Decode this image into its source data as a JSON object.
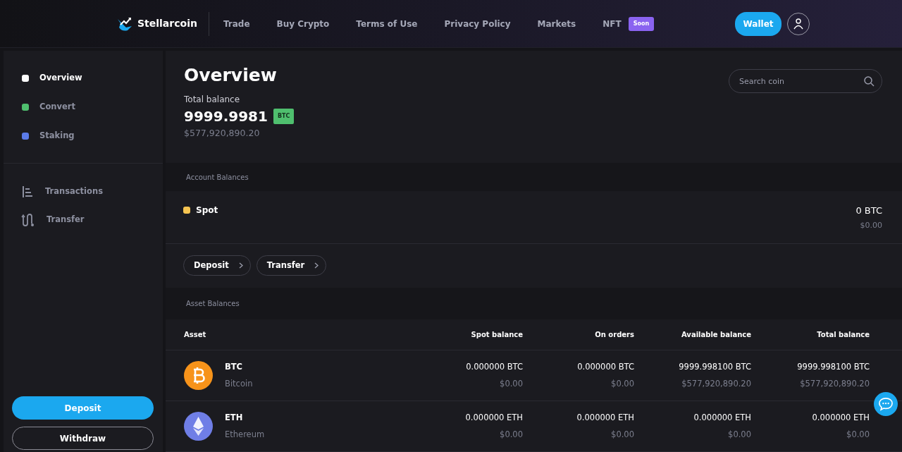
{
  "header": {
    "brand": "Stellarcoin",
    "nav": [
      {
        "label": "Trade"
      },
      {
        "label": "Buy Crypto"
      },
      {
        "label": "Terms of Use"
      },
      {
        "label": "Privacy Policy"
      },
      {
        "label": "Markets"
      },
      {
        "label": "NFT",
        "badge": "Soon"
      }
    ],
    "wallet_button": "Wallet"
  },
  "sidebar": {
    "items": [
      {
        "label": "Overview",
        "color": "#ffffff",
        "selected": true
      },
      {
        "label": "Convert",
        "color": "#4fbf6e",
        "selected": false
      },
      {
        "label": "Staking",
        "color": "#5b7be8",
        "selected": false
      }
    ],
    "links": [
      {
        "label": "Transactions",
        "kind": "list"
      },
      {
        "label": "Transfer",
        "kind": "route"
      }
    ],
    "deposit_button": "Deposit",
    "withdraw_button": "Withdraw"
  },
  "overview": {
    "title": "Overview",
    "balance_label": "Total balance",
    "balance": "9999.9981",
    "unit": "BTC",
    "fiat": "$577,920,890.20",
    "search": {
      "placeholder": "Search coin"
    }
  },
  "account_balances": {
    "title": "Account Balances",
    "accounts": [
      {
        "name": "Spot",
        "color": "#f5c451",
        "amount": "0 BTC",
        "fiat": "$0.00"
      }
    ],
    "actions": [
      "Deposit",
      "Transfer"
    ]
  },
  "asset_balances": {
    "title": "Asset Balances",
    "columns": [
      "Asset",
      "Spot balance",
      "On orders",
      "Available balance",
      "Total balance"
    ],
    "rows": [
      {
        "kind": "btc",
        "cells": [
          {
            "amount": "BTC",
            "fiat": "Bitcoin"
          },
          {
            "amount": "0.000000 BTC",
            "fiat": "$0.00"
          },
          {
            "amount": "0.000000 BTC",
            "fiat": "$0.00"
          },
          {
            "amount": "9999.998100 BTC",
            "fiat": "$577,920,890.20"
          },
          {
            "amount": "9999.998100 BTC",
            "fiat": "$577,920,890.20"
          }
        ]
      },
      {
        "kind": "eth",
        "cells": [
          {
            "amount": "ETH",
            "fiat": "Ethereum"
          },
          {
            "amount": "0.000000 ETH",
            "fiat": "$0.00"
          },
          {
            "amount": "0.000000 ETH",
            "fiat": "$0.00"
          },
          {
            "amount": "0.000000 ETH",
            "fiat": "$0.00"
          },
          {
            "amount": "0.000000 ETH",
            "fiat": "$0.00"
          }
        ]
      }
    ]
  }
}
